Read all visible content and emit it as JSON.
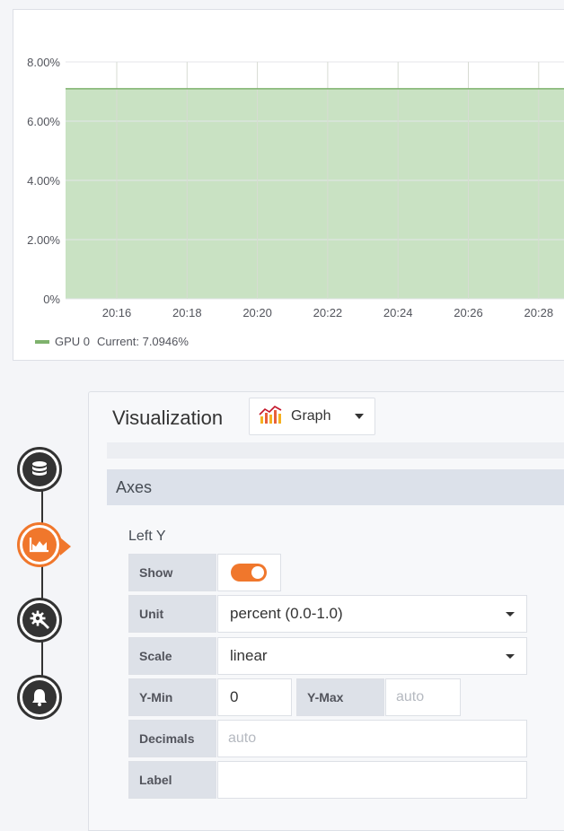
{
  "graph_panel": {
    "legend": {
      "series_name": "GPU 0",
      "current_text": "Current: 7.0946%"
    },
    "colors": {
      "fill": "#c9e2c3",
      "line": "#7eb26d",
      "grid": "#e4e6ea"
    }
  },
  "chart_data": {
    "type": "area",
    "x_ticks": [
      "20:16",
      "20:18",
      "20:20",
      "20:22",
      "20:24",
      "20:26",
      "20:28"
    ],
    "y_ticks": [
      "0%",
      "2.00%",
      "4.00%",
      "6.00%",
      "8.00%"
    ],
    "y_tick_values": [
      0,
      2,
      4,
      6,
      8
    ],
    "ylim": [
      0,
      8
    ],
    "series": [
      {
        "name": "GPU 0",
        "value": 7.0946
      }
    ],
    "grid": true,
    "legend_placement": "bottom-left"
  },
  "editor_nav": {
    "steps": [
      {
        "icon": "database-icon",
        "active": false
      },
      {
        "icon": "chart-area-icon",
        "active": true
      },
      {
        "icon": "gear-icon",
        "active": false
      },
      {
        "icon": "bell-icon",
        "active": false
      }
    ],
    "active_color": "#f0772c"
  },
  "options": {
    "visualization_title": "Visualization",
    "visualization_selected": "Graph",
    "axes_section": "Axes",
    "left_y_title": "Left Y",
    "show_label": "Show",
    "show_enabled": true,
    "unit_label": "Unit",
    "unit_value": "percent (0.0-1.0)",
    "scale_label": "Scale",
    "scale_value": "linear",
    "ymin_label": "Y-Min",
    "ymin_value": "0",
    "ymax_label": "Y-Max",
    "ymax_placeholder": "auto",
    "decimals_label": "Decimals",
    "decimals_placeholder": "auto",
    "label_label": "Label",
    "label_value": ""
  }
}
